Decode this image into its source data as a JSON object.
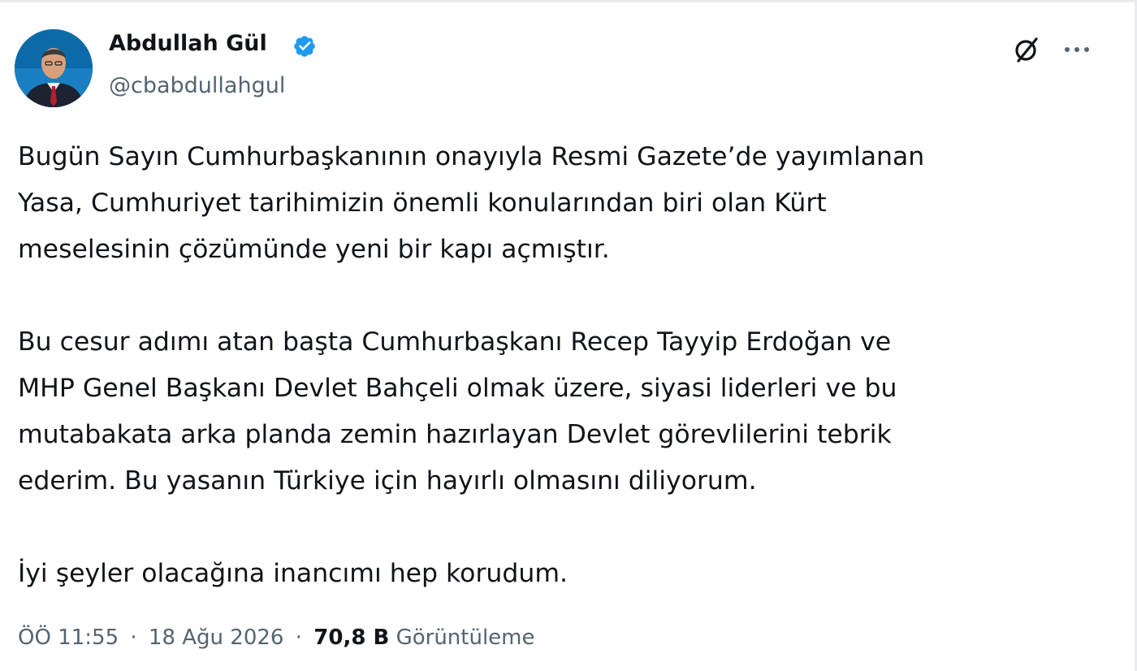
{
  "tweet": {
    "author": {
      "name": "Abdullah Gül",
      "handle": "@cbabdullahgul",
      "verified": true,
      "verified_color": "#1d9bf0"
    },
    "actions": {
      "grok_icon": "grok-slash-circle-icon",
      "more_icon": "more-horizontal-icon"
    },
    "body": {
      "lines": [
        "Bugün Sayın Cumhurbaşkanının onayıyla Resmi Gazete’de yayımlanan",
        "Yasa, Cumhuriyet tarihimizin önemli konularından biri olan Kürt",
        "meselesinin çözümünde yeni bir kapı açmıştır.",
        "",
        "Bu cesur adımı atan başta Cumhurbaşkanı Recep Tayyip Erdoğan ve",
        "MHP Genel Başkanı Devlet Bahçeli olmak üzere, siyasi liderleri ve bu",
        "mutabakata arka planda zemin hazırlayan Devlet görevlilerini tebrik",
        "ederim. Bu yasanın Türkiye için hayırlı olmasını diliyorum.",
        "",
        "İyi şeyler olacağına inancımı hep korudum."
      ]
    },
    "meta": {
      "time": "ÖÖ 11:55",
      "separator": "·",
      "date": "18 Ağu 2026",
      "views_count": "70,8 B",
      "views_label": "Görüntüleme"
    },
    "colors": {
      "text": "#0f1419",
      "secondary": "#536471",
      "avatar_bg": "#0d6aa8"
    }
  }
}
